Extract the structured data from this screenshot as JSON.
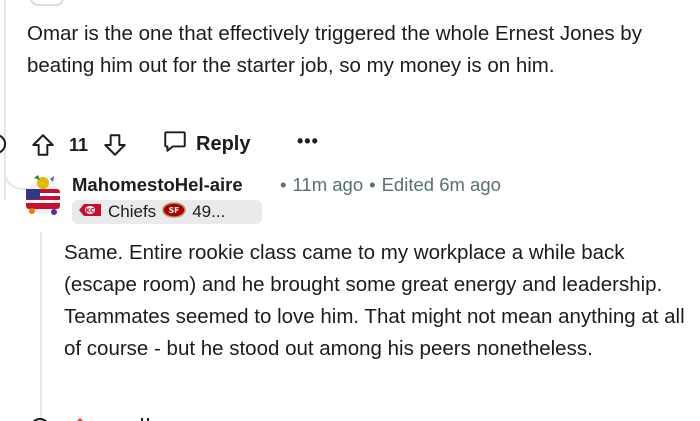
{
  "comment": {
    "body": "Omar is the one that effectively triggered the whole Ernest Jones by beating him out for the starter job, so my money is on him.",
    "vote_count": "11",
    "reply_label": "Reply",
    "more_label": "•••",
    "icons": [
      "collapse-icon",
      "upvote-icon",
      "downvote-icon",
      "reply-bubble-icon",
      "more-icon"
    ]
  },
  "reply": {
    "username": "MahomestoHel-aire",
    "time_ago": "11m ago",
    "edited": "Edited 6m ago",
    "flair_text": "Chiefs",
    "flair_text_2": "49...",
    "body": "Same. Entire rookie class came to my workplace a while back (escape room) and he brought some great energy and leadership. Teammates seemed to love him. That might not mean anything at all of course - but he stood out among his peers nonetheless.",
    "icons": [
      "avatar",
      "chiefs-logo-icon",
      "49ers-logo-icon"
    ]
  },
  "colors": {
    "text": "#1c1c1c",
    "meta": "#576f76",
    "flair_bg": "#e8eaec",
    "thread_line": "#e5e7e9",
    "chiefs_red": "#c8102e",
    "niners_red": "#aa0000",
    "niners_gold": "#b3995d"
  }
}
